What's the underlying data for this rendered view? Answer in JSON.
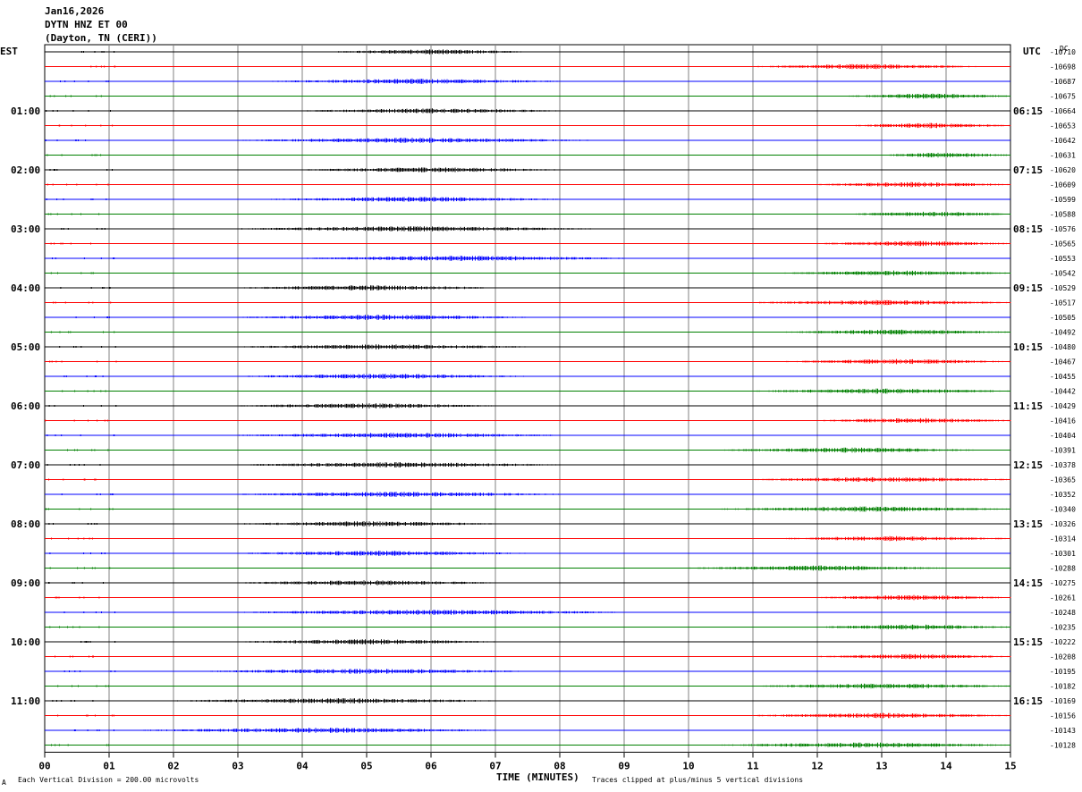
{
  "header": {
    "date": "Jan16,2026",
    "station": "DYTN HNZ ET 00",
    "location": "(Dayton, TN (CERI))"
  },
  "labels": {
    "left_zone": "EST",
    "right_zone": "UTC",
    "dc": "DC",
    "xlabel": "TIME (MINUTES)",
    "footer_left": "Each Vertical Division =  200.00 microvolts",
    "footer_right": "Traces clipped at plus/minus 5 vertical divisions",
    "corner_mark": "A"
  },
  "colors": {
    "trace_cycle": [
      "#000000",
      "#ff0000",
      "#0000ff",
      "#008000"
    ],
    "grid": "#808080",
    "frame": "#000000"
  },
  "chart_data": {
    "type": "line",
    "chart_kind": "helicorder",
    "x_range": [
      0,
      15
    ],
    "x_ticks": [
      "00",
      "01",
      "02",
      "03",
      "04",
      "05",
      "06",
      "07",
      "08",
      "09",
      "10",
      "11",
      "12",
      "13",
      "14",
      "15"
    ],
    "minutes_per_trace": 15,
    "trace_count": 48,
    "est_labels": [
      {
        "trace": 4,
        "label": "01:00"
      },
      {
        "trace": 8,
        "label": "02:00"
      },
      {
        "trace": 12,
        "label": "03:00"
      },
      {
        "trace": 16,
        "label": "04:00"
      },
      {
        "trace": 20,
        "label": "05:00"
      },
      {
        "trace": 24,
        "label": "06:00"
      },
      {
        "trace": 28,
        "label": "07:00"
      },
      {
        "trace": 32,
        "label": "08:00"
      },
      {
        "trace": 36,
        "label": "09:00"
      },
      {
        "trace": 40,
        "label": "10:00"
      },
      {
        "trace": 44,
        "label": "11:00"
      }
    ],
    "utc_labels": [
      {
        "trace": 4,
        "label": "06:15"
      },
      {
        "trace": 8,
        "label": "07:15"
      },
      {
        "trace": 12,
        "label": "08:15"
      },
      {
        "trace": 16,
        "label": "09:15"
      },
      {
        "trace": 20,
        "label": "10:15"
      },
      {
        "trace": 24,
        "label": "11:15"
      },
      {
        "trace": 28,
        "label": "12:15"
      },
      {
        "trace": 32,
        "label": "13:15"
      },
      {
        "trace": 36,
        "label": "14:15"
      },
      {
        "trace": 40,
        "label": "15:15"
      },
      {
        "trace": 44,
        "label": "16:15"
      }
    ],
    "dc_offsets": [
      "-10710",
      "-10698",
      "-10687",
      "-10675",
      "-10664",
      "-10653",
      "-10642",
      "-10631",
      "-10620",
      "-10609",
      "-10599",
      "-10588",
      "-10576",
      "-10565",
      "-10553",
      "-10542",
      "-10529",
      "-10517",
      "-10505",
      "-10492",
      "-10480",
      "-10467",
      "-10455",
      "-10442",
      "-10429",
      "-10416",
      "-10404",
      "-10391",
      "-10378",
      "-10365",
      "-10352",
      "-10340",
      "-10326",
      "-10314",
      "-10301",
      "-10288",
      "-10275",
      "-10261",
      "-10248",
      "-10235",
      "-10222",
      "-10208",
      "-10195",
      "-10182",
      "-10169",
      "-10156",
      "-10143",
      "-10128"
    ],
    "activity_windows": [
      [
        4.5,
        7.5
      ],
      [
        11,
        14.5
      ],
      [
        3.5,
        8
      ],
      [
        12.5,
        15
      ],
      [
        4,
        8
      ],
      [
        12.5,
        15
      ],
      [
        3,
        8.5
      ],
      [
        13,
        15
      ],
      [
        4,
        8
      ],
      [
        12,
        15
      ],
      [
        3.5,
        8
      ],
      [
        12.5,
        15
      ],
      [
        3,
        8.5
      ],
      [
        12,
        15
      ],
      [
        4,
        9
      ],
      [
        11.5,
        15
      ],
      [
        3,
        7
      ],
      [
        11,
        15
      ],
      [
        3,
        7.5
      ],
      [
        11.5,
        15
      ],
      [
        3,
        7.5
      ],
      [
        11.5,
        15
      ],
      [
        3,
        7.5
      ],
      [
        11,
        15
      ],
      [
        3,
        7
      ],
      [
        12,
        15
      ],
      [
        3,
        8
      ],
      [
        10.5,
        14.5
      ],
      [
        3,
        8
      ],
      [
        11,
        15
      ],
      [
        3,
        8
      ],
      [
        10.5,
        15
      ],
      [
        3,
        7
      ],
      [
        11.5,
        15
      ],
      [
        3,
        7.5
      ],
      [
        10,
        14
      ],
      [
        3,
        7
      ],
      [
        12,
        15
      ],
      [
        3,
        9
      ],
      [
        12,
        15
      ],
      [
        3,
        7
      ],
      [
        12,
        15
      ],
      [
        2.5,
        7.5
      ],
      [
        11,
        15
      ],
      [
        2,
        7
      ],
      [
        11,
        15
      ],
      [
        1.5,
        7
      ],
      [
        10.5,
        15
      ]
    ]
  }
}
